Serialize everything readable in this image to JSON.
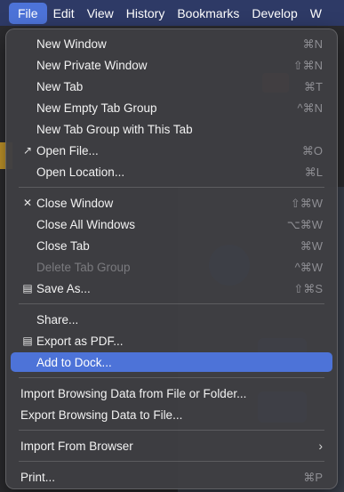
{
  "menubar": {
    "items": [
      "File",
      "Edit",
      "View",
      "History",
      "Bookmarks",
      "Develop",
      "W"
    ]
  },
  "file_menu": {
    "new_window": {
      "label": "New Window",
      "shortcut": "⌘N"
    },
    "new_private_window": {
      "label": "New Private Window",
      "shortcut": "⇧⌘N"
    },
    "new_tab": {
      "label": "New Tab",
      "shortcut": "⌘T"
    },
    "new_empty_tab_group": {
      "label": "New Empty Tab Group",
      "shortcut": "^⌘N"
    },
    "new_tab_group_with_this_tab": {
      "label": "New Tab Group with This Tab"
    },
    "open_file": {
      "label": "Open File...",
      "shortcut": "⌘O"
    },
    "open_location": {
      "label": "Open Location...",
      "shortcut": "⌘L"
    },
    "close_window": {
      "label": "Close Window",
      "shortcut": "⇧⌘W"
    },
    "close_all_windows": {
      "label": "Close All Windows",
      "shortcut": "⌥⌘W"
    },
    "close_tab": {
      "label": "Close Tab",
      "shortcut": "⌘W"
    },
    "delete_tab_group": {
      "label": "Delete Tab Group",
      "shortcut": "^⌘W"
    },
    "save_as": {
      "label": "Save As...",
      "shortcut": "⇧⌘S"
    },
    "share": {
      "label": "Share..."
    },
    "export_as_pdf": {
      "label": "Export as PDF..."
    },
    "add_to_dock": {
      "label": "Add to Dock..."
    },
    "import_browsing_data": {
      "label": "Import Browsing Data from File or Folder..."
    },
    "export_browsing_data": {
      "label": "Export Browsing Data to File..."
    },
    "import_from_browser": {
      "label": "Import From Browser"
    },
    "print": {
      "label": "Print...",
      "shortcut": "⌘P"
    }
  },
  "colors": {
    "menubar_bg": "#2e3a66",
    "highlight": "#4d73d8",
    "menu_bg": "#3e3e42"
  }
}
